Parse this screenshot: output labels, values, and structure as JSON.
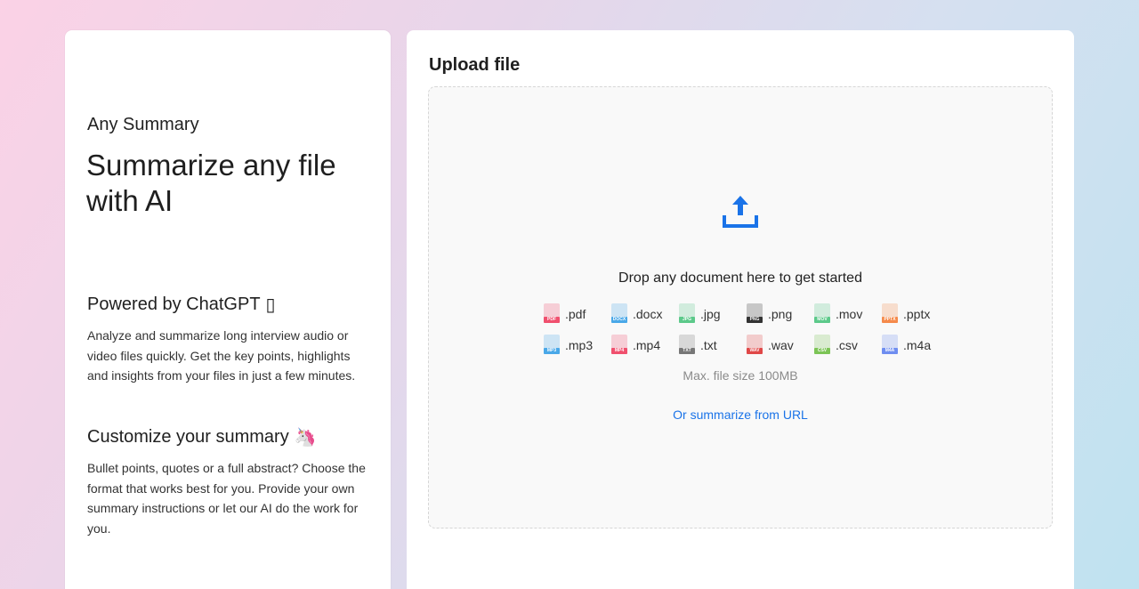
{
  "left": {
    "brand": "Any Summary",
    "hero": "Summarize any file with AI",
    "features": [
      {
        "title": "Powered by ChatGPT",
        "emoji": "▯",
        "text": "Analyze and summarize long interview audio or video files quickly. Get the key points, highlights and insights from your files in just a few minutes."
      },
      {
        "title": "Customize your summary",
        "emoji": "🦄",
        "text": "Bullet points, quotes or a full abstract? Choose the format that works best for you. Provide your own summary instructions or let our AI do the work for you."
      }
    ]
  },
  "upload": {
    "title": "Upload file",
    "drop_text": "Drop any document here to get started",
    "icon": "upload-icon",
    "accent": "#1a73e8",
    "file_types_row1": [
      {
        "ext": ".pdf",
        "badge": "PDF",
        "color": "#f0506e"
      },
      {
        "ext": ".docx",
        "badge": "DOCX",
        "color": "#4aa8e8"
      },
      {
        "ext": ".jpg",
        "badge": "JPG",
        "color": "#5cc98a"
      },
      {
        "ext": ".png",
        "badge": "PNG",
        "color": "#333333"
      },
      {
        "ext": ".mov",
        "badge": "MOV",
        "color": "#5cc98a"
      },
      {
        "ext": ".pptx",
        "badge": "PPTX",
        "color": "#f58a4b"
      }
    ],
    "file_types_row2": [
      {
        "ext": ".mp3",
        "badge": "MP3",
        "color": "#4aa8e8"
      },
      {
        "ext": ".mp4",
        "badge": "MP4",
        "color": "#f0506e"
      },
      {
        "ext": ".txt",
        "badge": "TXT",
        "color": "#777777"
      },
      {
        "ext": ".wav",
        "badge": "WAV",
        "color": "#e04848"
      },
      {
        "ext": ".csv",
        "badge": "CSV",
        "color": "#7cc456"
      },
      {
        "ext": ".m4a",
        "badge": "M4A",
        "color": "#6f8ef0"
      }
    ],
    "max_size": "Max. file size 100MB",
    "url_link": "Or summarize from URL"
  }
}
